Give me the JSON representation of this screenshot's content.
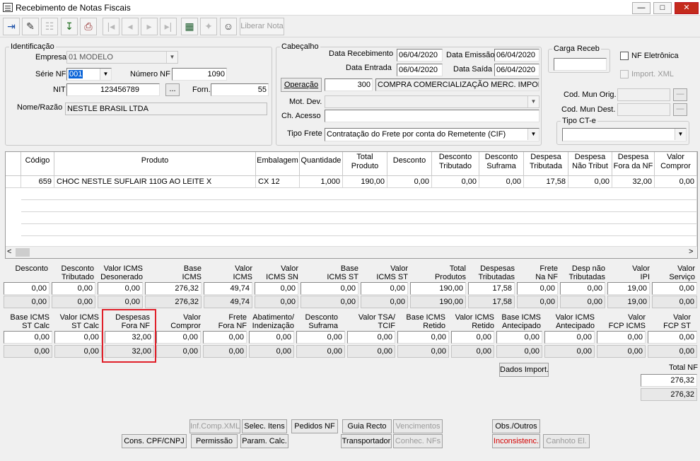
{
  "window": {
    "title": "Recebimento de Notas Fiscais",
    "minimize": "—",
    "maximize": "□",
    "close": "✕"
  },
  "toolbar": {
    "liberar_label": "Liberar Nota"
  },
  "identificacao": {
    "legend": "Identificação",
    "empresa_label": "Empresa",
    "empresa_value": "01 MODELO",
    "serie_label": "Série NF",
    "serie_value": "001",
    "numero_label": "Número NF",
    "numero_value": "1090",
    "nit_label": "NIT",
    "nit_value": "123456789",
    "lookup_label": "...",
    "forn_label": "Forn.",
    "forn_value": "55",
    "nome_label": "Nome/Razão",
    "nome_value": "NESTLE BRASIL LTDA"
  },
  "cabecalho": {
    "legend": "Cabeçalho",
    "data_receb_label": "Data Recebimento",
    "data_receb": "06/04/2020",
    "data_emissao_label": "Data Emissão",
    "data_emissao": "06/04/2020",
    "data_entrada_label": "Data Entrada",
    "data_entrada": "06/04/2020",
    "data_saida_label": "Data Saída",
    "data_saida": "06/04/2020",
    "operacao_btn": "Operação",
    "operacao_code": "300",
    "operacao_desc": "COMPRA COMERCIALIZAÇÃO MERC. IMPOR",
    "mot_dev_label": "Mot. Dev.",
    "ch_acesso_label": "Ch. Acesso",
    "tipo_frete_label": "Tipo Frete",
    "tipo_frete_value": "Contratação do Frete por conta do Remetente (CIF)"
  },
  "right_panel": {
    "carga_legend": "Carga Receb",
    "nf_eletronica": "NF Eletrônica",
    "import_xml": "Import. XML",
    "cod_mun_orig": "Cod. Mun Orig.",
    "cod_mun_dest": "Cod. Mun Dest.",
    "tipo_cte_legend": "Tipo CT-e"
  },
  "grid": {
    "headers": [
      "Código",
      "Produto",
      "Embalagem",
      "Quantidade",
      "Total\nProduto",
      "Desconto",
      "Desconto\nTributado",
      "Desconto\nSuframa",
      "Despesa\nTributada",
      "Despesa\nNão Tribut",
      "Despesa\nFora da NF",
      "Valor\nCompror"
    ],
    "row": [
      "659",
      "CHOC NESTLE SUFLAIR 110G AO LEITE X",
      "CX 12",
      "1,000",
      "190,00",
      "0,00",
      "0,00",
      "0,00",
      "17,58",
      "0,00",
      "32,00",
      "0,00"
    ],
    "scroll_left": "<",
    "scroll_right": ">"
  },
  "totais1": {
    "labels": [
      "Desconto",
      "Desconto\nTributado",
      "Valor ICMS\nDesonerado",
      "Base\nICMS",
      "Valor\nICMS",
      "Valor\nICMS SN",
      "Base\nICMS ST",
      "Valor\nICMS ST",
      "Total\nProdutos",
      "Despesas\nTributadas",
      "Frete\nNa NF",
      "Desp não\nTributadas",
      "Valor\nIPI",
      "Valor\nServiço"
    ],
    "row1": [
      "0,00",
      "0,00",
      "0,00",
      "276,32",
      "49,74",
      "0,00",
      "0,00",
      "0,00",
      "190,00",
      "17,58",
      "0,00",
      "0,00",
      "19,00",
      "0,00"
    ],
    "row2": [
      "0,00",
      "0,00",
      "0,00",
      "276,32",
      "49,74",
      "0,00",
      "0,00",
      "0,00",
      "190,00",
      "17,58",
      "0,00",
      "0,00",
      "19,00",
      "0,00"
    ]
  },
  "totais2": {
    "labels": [
      "Base ICMS\nST Calc",
      "Valor ICMS\nST Calc",
      "Despesas\nFora NF",
      "Valor\nCompror",
      "Frete\nFora NF",
      "Abatimento/\nIndenização",
      "Desconto\nSuframa",
      "Valor TSA/\nTCIF",
      "Base ICMS\nRetido",
      "Valor ICMS\nRetido",
      "Base ICMS\nAntecipado",
      "Valor ICMS\nAntecipado",
      "Valor\nFCP ICMS",
      "Valor\nFCP ST"
    ],
    "row1": [
      "0,00",
      "0,00",
      "32,00",
      "0,00",
      "0,00",
      "0,00",
      "0,00",
      "0,00",
      "0,00",
      "0,00",
      "0,00",
      "0,00",
      "0,00",
      "0,00"
    ],
    "row2": [
      "0,00",
      "0,00",
      "32,00",
      "0,00",
      "0,00",
      "0,00",
      "0,00",
      "0,00",
      "0,00",
      "0,00",
      "0,00",
      "0,00",
      "0,00",
      "0,00"
    ]
  },
  "dados_import": "Dados Import.",
  "total_nf": {
    "label": "Total NF",
    "value1": "276,32",
    "value2": "276,32"
  },
  "buttons": {
    "inf_comp_xml": "Inf.Comp.XML",
    "selec_itens": "Selec. Itens",
    "pedidos_nf": "Pedidos NF",
    "guia_recto": "Guia Recto",
    "vencimentos": "Vencimentos",
    "obs_outros": "Obs./Outros",
    "cons_cpf": "Cons. CPF/CNPJ",
    "permissao": "Permissão",
    "param_calc": "Param. Calc.",
    "transportador": "Transportador",
    "conhec_nfs": "Conhec. NFs",
    "inconsistenc": "Inconsistenc.",
    "canhoto": "Canhoto El."
  },
  "colors": {
    "highlight": "#e0202a",
    "inconsistenc": "#d40000",
    "selection": "#0a64d8"
  }
}
